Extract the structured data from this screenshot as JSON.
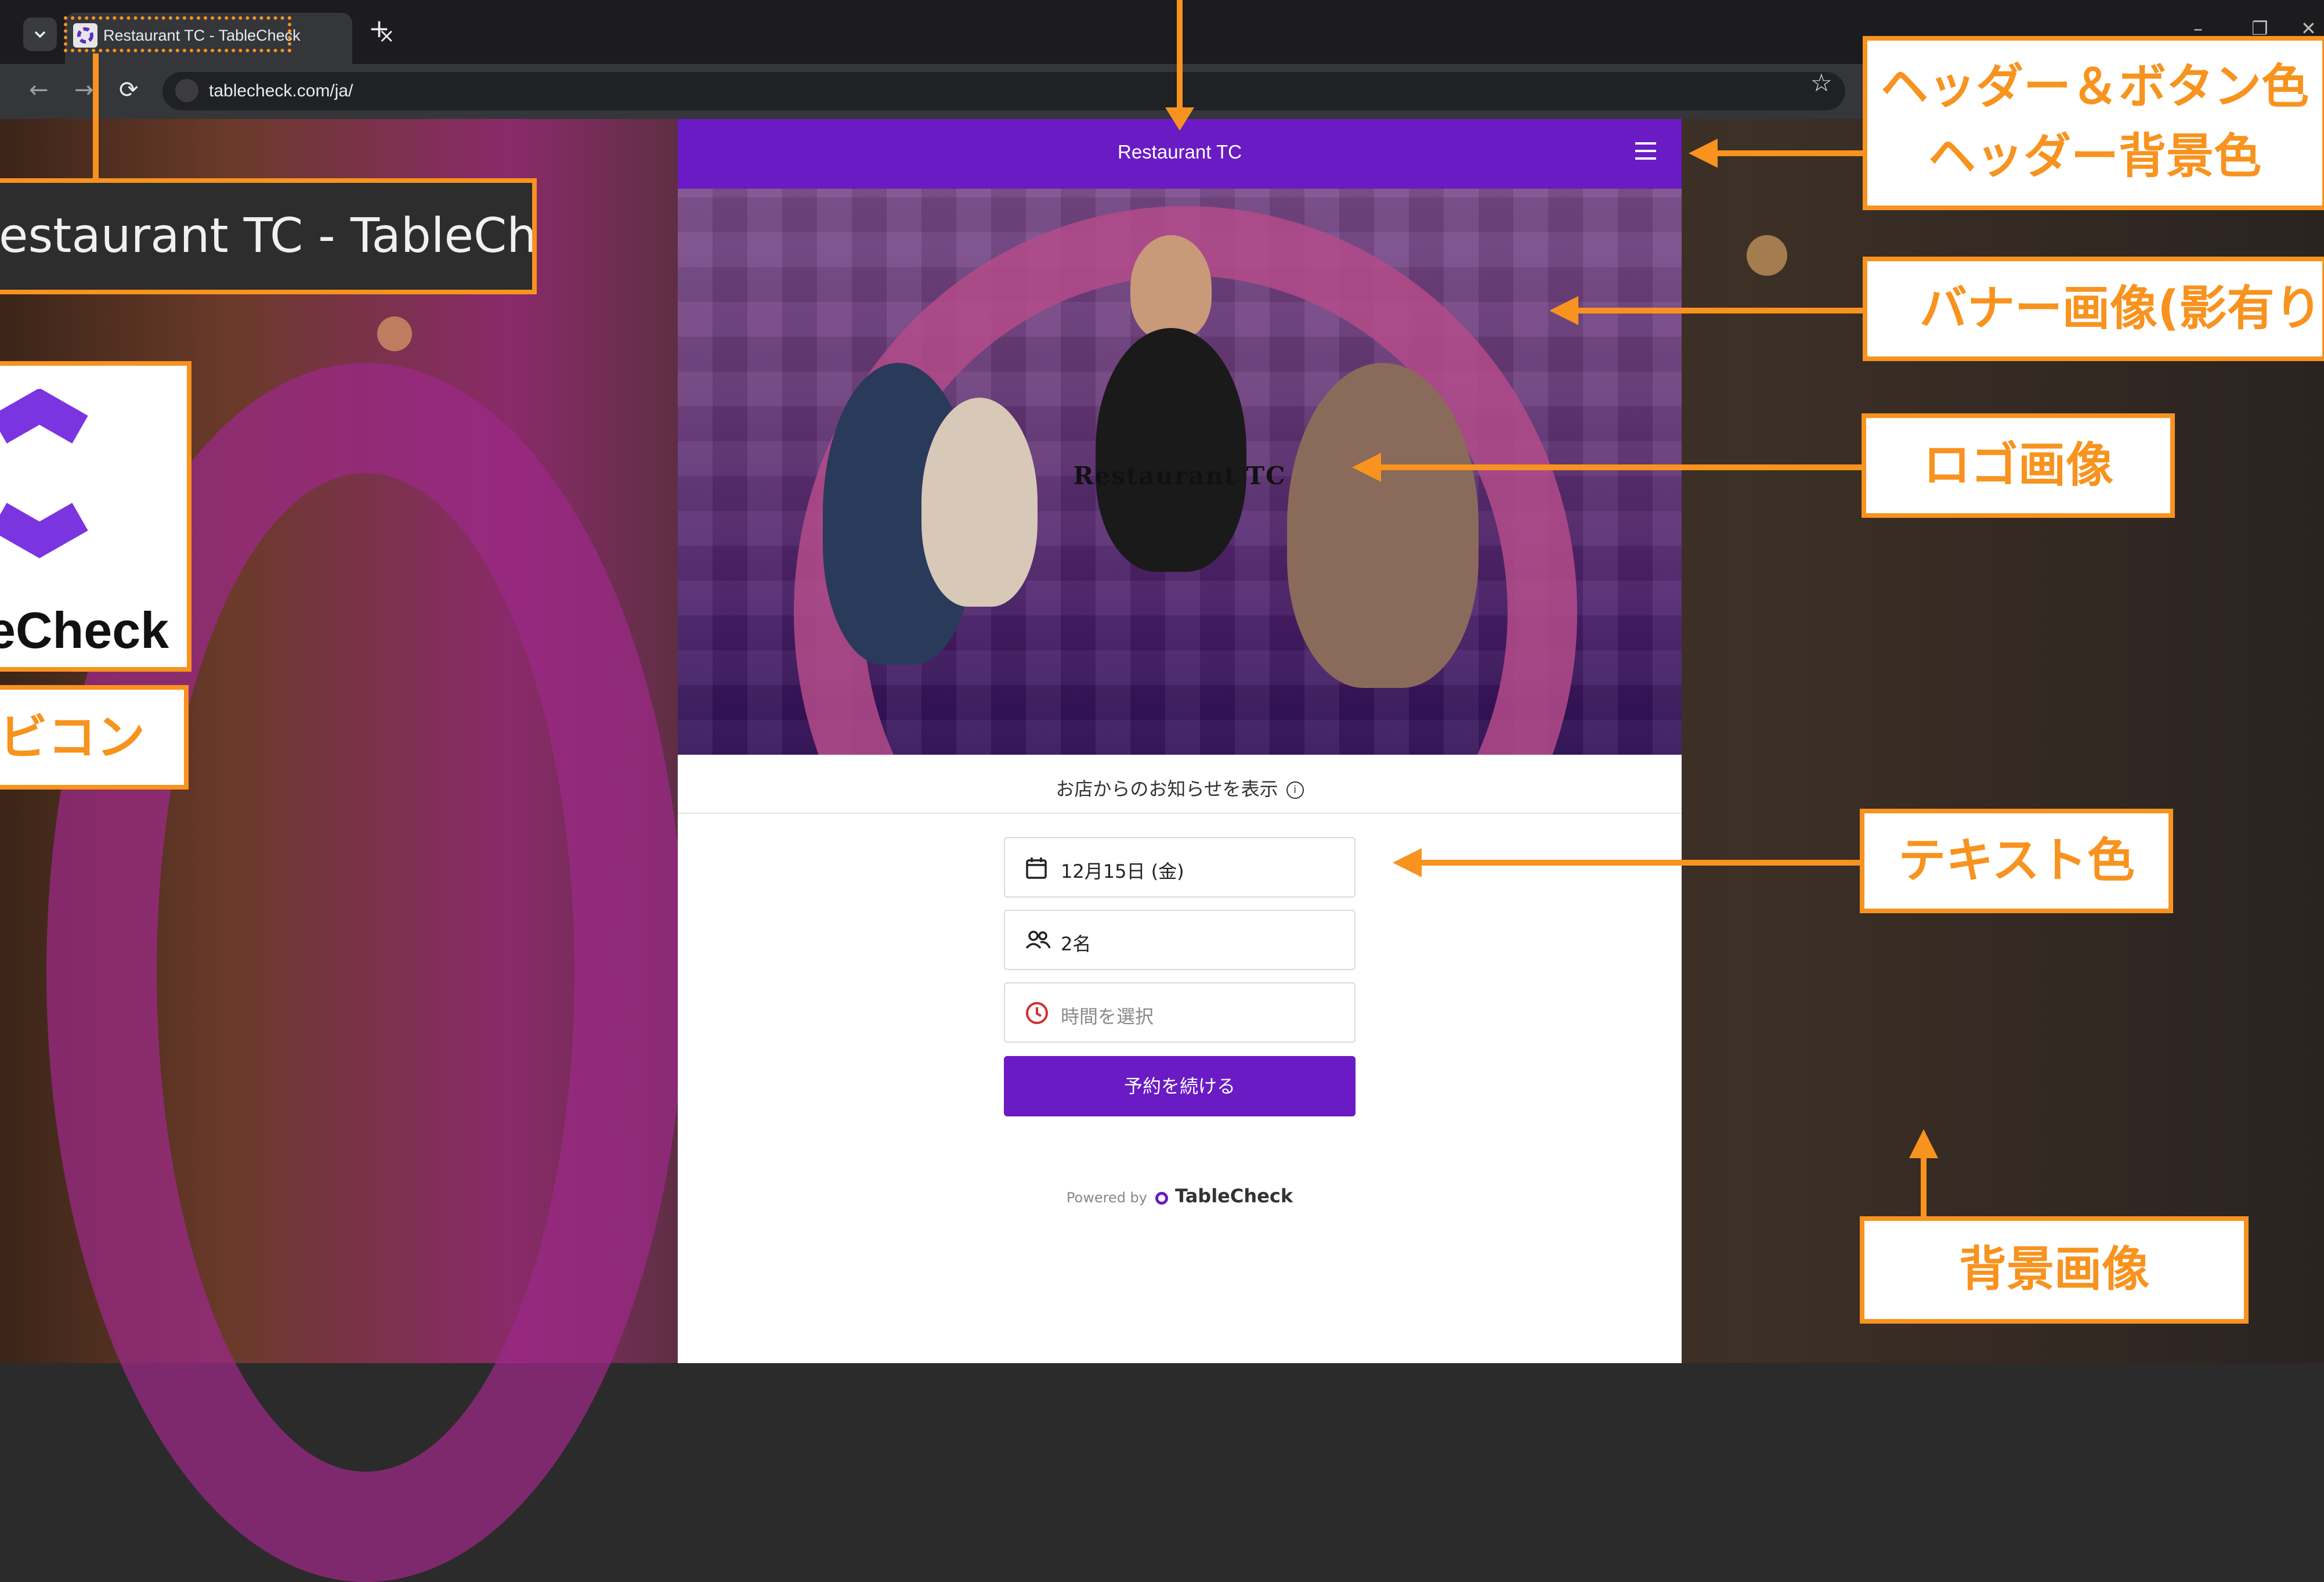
{
  "browser": {
    "tab_title": "Restaurant TC - TableCheck",
    "tab_close": "×",
    "new_tab": "+",
    "url": "tablecheck.com/ja/",
    "back": "←",
    "forward": "→",
    "reload": "⟳",
    "star": "☆",
    "minimize": "–",
    "restore": "❐",
    "close_window": "✕"
  },
  "app": {
    "header_title": "Restaurant TC",
    "banner_logo_text": "Restaurant TC",
    "notice_text": "お店からのお知らせを表示",
    "info_glyph": "i",
    "date_value": "12月15日 (金)",
    "party_value": "2名",
    "time_placeholder": "時間を選択",
    "continue_label": "予約を続ける",
    "powered_by": "Powered by",
    "brand_name": "TableCheck",
    "colors": {
      "header": "#6a1bc4",
      "button": "#6a1bc4",
      "clock_icon": "#d32f2f"
    }
  },
  "annotations": {
    "tab_zoom": "estaurant TC - TableCheck",
    "favicon_caption": "ビコン",
    "favicon_word": "eCheck",
    "header_color_line1": "ヘッダー＆ボタン色",
    "header_color_line2": "ヘッダー背景色",
    "banner_image": "バナー画像(影有り",
    "logo_image": "ロゴ画像",
    "text_color": "テキスト色",
    "background_image": "背景画像",
    "accent": "#f7931e"
  },
  "icons": [
    "tab-dropdown-icon",
    "tablecheck-favicon-icon",
    "site-info-icon",
    "menu-icon",
    "calendar-icon",
    "people-icon",
    "clock-icon",
    "info-icon",
    "star-icon"
  ]
}
